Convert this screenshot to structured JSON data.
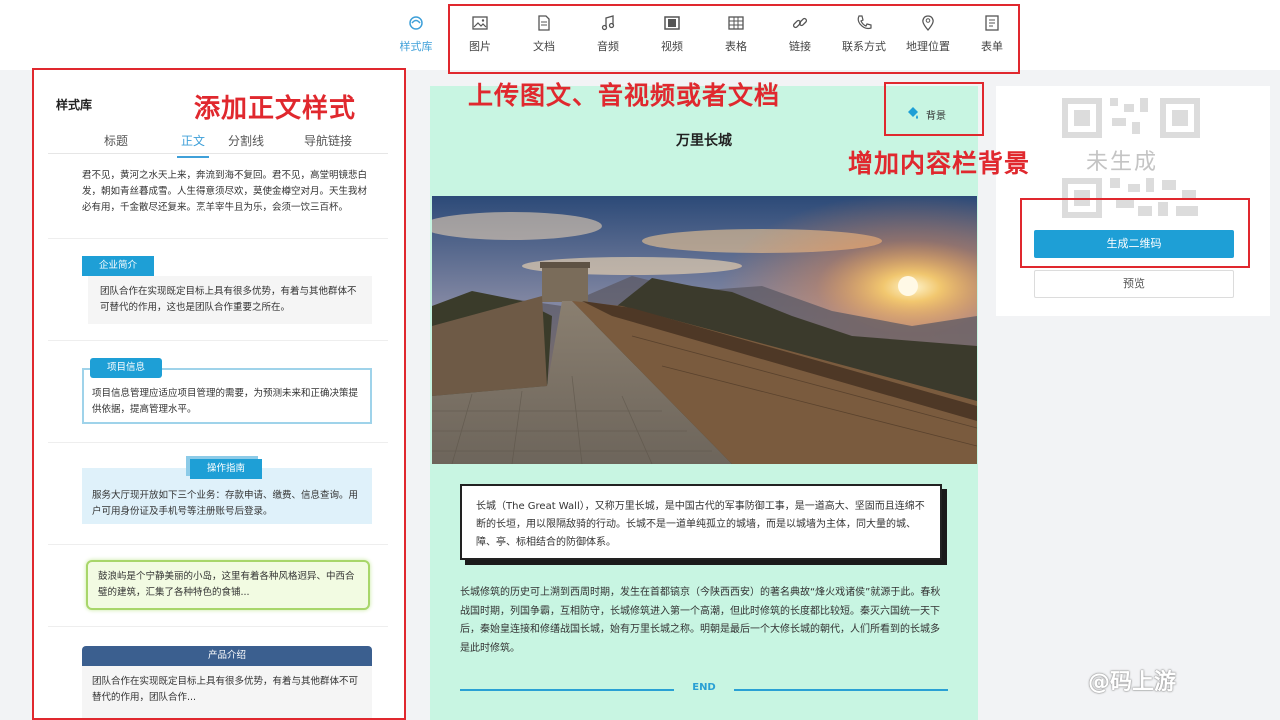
{
  "toolbar": {
    "items": [
      {
        "label": "样式库",
        "icon": "style-library-icon"
      },
      {
        "label": "图片",
        "icon": "image-icon"
      },
      {
        "label": "文档",
        "icon": "document-icon"
      },
      {
        "label": "音频",
        "icon": "music-icon"
      },
      {
        "label": "视频",
        "icon": "video-icon"
      },
      {
        "label": "表格",
        "icon": "table-icon"
      },
      {
        "label": "链接",
        "icon": "link-icon"
      },
      {
        "label": "联系方式",
        "icon": "phone-icon"
      },
      {
        "label": "地理位置",
        "icon": "location-icon"
      },
      {
        "label": "表单",
        "icon": "form-icon"
      }
    ]
  },
  "annotations": {
    "style": "添加正文样式",
    "upload": "上传图文、音视频或者文档",
    "background": "增加内容栏背景"
  },
  "left_panel": {
    "title": "样式库",
    "tabs": [
      "标题",
      "正文",
      "分割线",
      "导航链接"
    ],
    "active_tab": "正文",
    "cards": [
      {
        "text": "君不见，黄河之水天上来，奔流到海不复回。君不见，高堂明镜悲白发，朝如青丝暮成雪。人生得意须尽欢，莫使金樽空对月。天生我材必有用，千金散尽还复来。烹羊宰牛且为乐，会须一饮三百杯。"
      },
      {
        "tag": "企业简介",
        "text": "团队合作在实现既定目标上具有很多优势，有着与其他群体不可替代的作用，这也是团队合作重要之所在。"
      },
      {
        "tag": "项目信息",
        "text": "项目信息管理应适应项目管理的需要，为预测未来和正确决策提供依据，提高管理水平。"
      },
      {
        "tag": "操作指南",
        "text": "服务大厅现开放如下三个业务：存款申请、缴费、信息查询。用户可用身份证及手机号等注册账号后登录。"
      },
      {
        "text": "鼓浪屿是个宁静美丽的小岛，这里有着各种风格迥异、中西合璧的建筑，汇集了各种特色的食铺..."
      },
      {
        "tag": "产品介绍",
        "text": "团队合作在实现既定目标上具有很多优势，有着与其他群体不可替代的作用，团队合作..."
      }
    ]
  },
  "article": {
    "bg_button": "背景",
    "title": "万里长城",
    "quote": "长城（The Great Wall），又称万里长城，是中国古代的军事防御工事，是一道高大、坚固而且连绵不断的长垣，用以限隔敌骑的行动。长城不是一道单纯孤立的城墙，而是以城墙为主体，同大量的城、障、亭、标相结合的防御体系。",
    "body": "长城修筑的历史可上溯到西周时期，发生在首都镐京（今陕西西安）的著名典故“烽火戏诸侯”就源于此。春秋战国时期，列国争霸，互相防守，长城修筑进入第一个高潮，但此时修筑的长度都比较短。秦灭六国统一天下后，秦始皇连接和修缮战国长城，始有万里长城之称。明朝是最后一个大修长城的朝代，人们所看到的长城多是此时修筑。",
    "end": "END"
  },
  "right_panel": {
    "qr_placeholder": "未生成",
    "generate_button": "生成二维码",
    "preview_button": "预览"
  },
  "watermark": "@码上游",
  "colors": {
    "accent": "#1e9fd6",
    "annotation_red": "#e0282e",
    "article_bg": "#c8f5e2"
  }
}
